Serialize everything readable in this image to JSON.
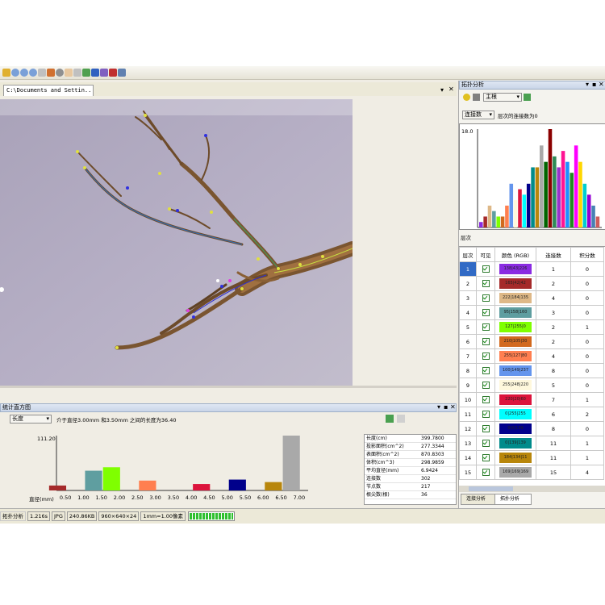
{
  "main_tab": {
    "label": "C:\\Documents and Settin..."
  },
  "right_panel": {
    "title": "拓扑分析",
    "mode_select": "主根",
    "sort_select": "连接数",
    "chart_caption": "层次的连接数为0",
    "chart_ymax_label": "18.0",
    "chart_xlabel": "层次",
    "table_headers": [
      "层次",
      "可见",
      "颜色 (RGB)",
      "连接数",
      "积分数"
    ],
    "rows": [
      {
        "level": "1",
        "rgb": "138|43|226",
        "color": "#8a2be2",
        "links": "1",
        "score": "0"
      },
      {
        "level": "2",
        "rgb": "165|42|42",
        "color": "#a52a2a",
        "links": "2",
        "score": "0"
      },
      {
        "level": "3",
        "rgb": "222|184|135",
        "color": "#deb887",
        "links": "4",
        "score": "0"
      },
      {
        "level": "4",
        "rgb": "95|158|160",
        "color": "#5f9ea0",
        "links": "3",
        "score": "0"
      },
      {
        "level": "5",
        "rgb": "127|255|0",
        "color": "#7fff00",
        "links": "2",
        "score": "1"
      },
      {
        "level": "6",
        "rgb": "210|105|30",
        "color": "#d2691e",
        "links": "2",
        "score": "0"
      },
      {
        "level": "7",
        "rgb": "255|127|80",
        "color": "#ff7f50",
        "links": "4",
        "score": "0"
      },
      {
        "level": "8",
        "rgb": "100|149|237",
        "color": "#6495ed",
        "links": "8",
        "score": "0"
      },
      {
        "level": "9",
        "rgb": "255|248|220",
        "color": "#fff8dc",
        "links": "5",
        "score": "0"
      },
      {
        "level": "10",
        "rgb": "220|20|60",
        "color": "#dc143c",
        "links": "7",
        "score": "1"
      },
      {
        "level": "11",
        "rgb": "0|255|255",
        "color": "#00ffff",
        "links": "6",
        "score": "2"
      },
      {
        "level": "12",
        "rgb": "0|0|139",
        "color": "#00008b",
        "links": "8",
        "score": "0"
      },
      {
        "level": "13",
        "rgb": "0|139|139",
        "color": "#008b8b",
        "links": "11",
        "score": "1"
      },
      {
        "level": "14",
        "rgb": "184|134|11",
        "color": "#b8860b",
        "links": "11",
        "score": "1"
      },
      {
        "level": "15",
        "rgb": "169|169|169",
        "color": "#a9a9a9",
        "links": "15",
        "score": "4"
      }
    ],
    "bottom_tabs": [
      "连接分析",
      "拓扑分析"
    ]
  },
  "bottom_panel": {
    "title": "统计直方图",
    "select": "长度",
    "caption": "介于直径3.00mm 和3.50mm 之间的长度为36.40",
    "ymax_label": "111.20",
    "xaxis_label": "直径(mm)",
    "stats": [
      {
        "k": "长度(cm)",
        "v": "399.7800"
      },
      {
        "k": "投影面积(cm^2)",
        "v": "277.3344"
      },
      {
        "k": "表面积(cm^2)",
        "v": "870.8303"
      },
      {
        "k": "体积(cm^3)",
        "v": "298.9859"
      },
      {
        "k": "平均直径(mm)",
        "v": "6.9424"
      },
      {
        "k": "连接数",
        "v": "302"
      },
      {
        "k": "节点数",
        "v": "217"
      },
      {
        "k": "根尖数(根)",
        "v": "36"
      }
    ]
  },
  "status": {
    "cells": [
      "拓扑分析",
      "1.216s",
      "JPG",
      "240.86KB",
      "960×640×24",
      "1mm=1.00像素"
    ],
    "progress": 1.0
  },
  "chart_data": [
    {
      "type": "bar",
      "title": "",
      "xlabel": "直径(mm)",
      "ylabel": "",
      "categories": [
        "0.50",
        "1.00",
        "1.50",
        "2.00",
        "2.50",
        "3.00",
        "3.50",
        "4.00",
        "4.50",
        "5.00",
        "5.50",
        "6.00",
        "6.50",
        "7.00"
      ],
      "values": [
        10,
        0,
        40,
        47,
        0,
        20,
        0,
        0,
        13,
        0,
        22,
        0,
        17,
        111.2
      ],
      "colors": [
        "#a52a2a",
        "#a52a2a",
        "#5f9ea0",
        "#7fff00",
        "#deb887",
        "#ff7f50",
        "#6495ed",
        "#6495ed",
        "#dc143c",
        "#dc143c",
        "#00008b",
        "#00008b",
        "#b8860b",
        "#a9a9a9"
      ],
      "ylim": [
        0,
        111.2
      ],
      "grid": false
    },
    {
      "type": "bar",
      "title": "",
      "xlabel": "层次",
      "ylabel": "",
      "values": [
        1,
        2,
        4,
        3,
        2,
        2,
        4,
        8,
        5,
        7,
        6,
        8,
        11,
        11,
        15,
        12,
        18,
        13,
        11,
        14,
        12,
        10,
        15,
        12,
        8,
        6,
        4,
        2
      ],
      "colors": [
        "#8a2be2",
        "#a52a2a",
        "#deb887",
        "#5f9ea0",
        "#7fff00",
        "#d2691e",
        "#ff7f50",
        "#6495ed",
        "#fff8dc",
        "#dc143c",
        "#00ffff",
        "#00008b",
        "#008b8b",
        "#b8860b",
        "#a9a9a9",
        "#006400",
        "#8b0000",
        "#2e8b57",
        "#9932cc",
        "#ff1493",
        "#1e90ff",
        "#228b22",
        "#ff00ff",
        "#ffd700",
        "#00ced1",
        "#9400d3",
        "#4682b4",
        "#cd5c5c"
      ],
      "ylim": [
        0,
        18
      ],
      "grid": false
    }
  ]
}
